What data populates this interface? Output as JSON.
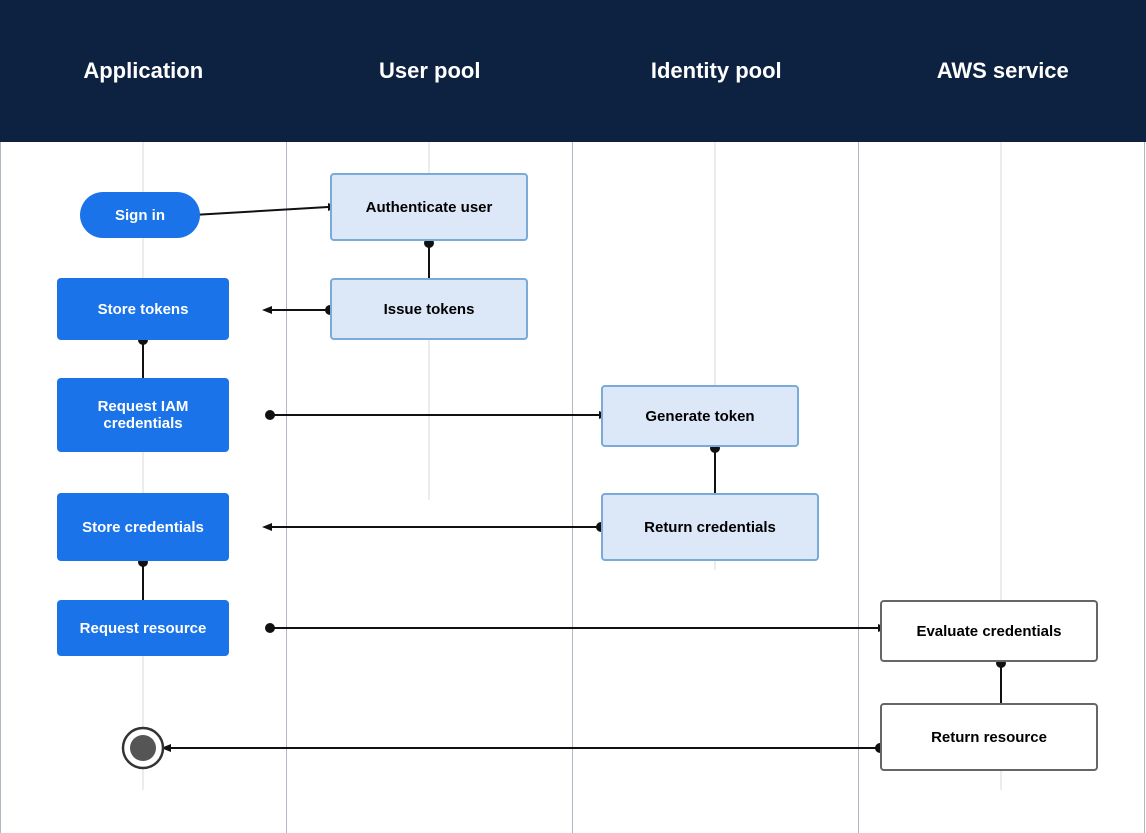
{
  "columns": [
    {
      "id": "application",
      "label": "Application"
    },
    {
      "id": "user-pool",
      "label": "User pool"
    },
    {
      "id": "identity-pool",
      "label": "Identity pool"
    },
    {
      "id": "aws-service",
      "label": "AWS service"
    }
  ],
  "nodes": {
    "sign-in": {
      "label": "Sign in"
    },
    "authenticate-user": {
      "label": "Authenticate user"
    },
    "store-tokens": {
      "label": "Store tokens"
    },
    "issue-tokens": {
      "label": "Issue tokens"
    },
    "request-iam": {
      "label": "Request IAM\ncredentials"
    },
    "generate-token": {
      "label": "Generate token"
    },
    "store-credentials": {
      "label": "Store credentials"
    },
    "return-credentials": {
      "label": "Return credentials"
    },
    "request-resource": {
      "label": "Request resource"
    },
    "evaluate-credentials": {
      "label": "Evaluate credentials"
    },
    "return-resource": {
      "label": "Return resource"
    }
  }
}
